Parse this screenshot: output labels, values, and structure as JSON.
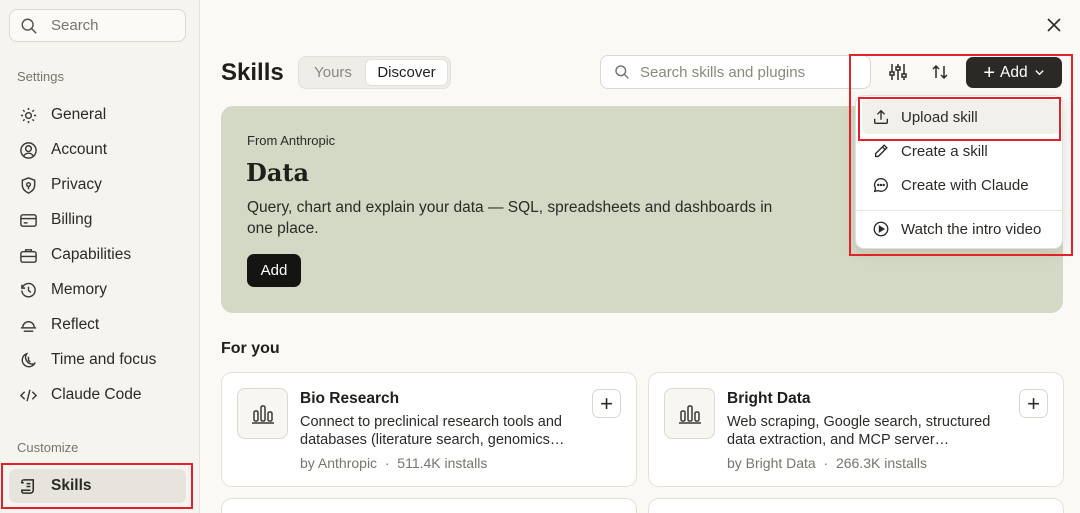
{
  "sidebar": {
    "search_placeholder": "Search",
    "settings_label": "Settings",
    "customize_label": "Customize",
    "items": [
      {
        "label": "General",
        "icon": "gear-icon"
      },
      {
        "label": "Account",
        "icon": "user-circle-icon"
      },
      {
        "label": "Privacy",
        "icon": "shield-icon"
      },
      {
        "label": "Billing",
        "icon": "credit-card-icon"
      },
      {
        "label": "Capabilities",
        "icon": "briefcase-icon"
      },
      {
        "label": "Memory",
        "icon": "history-icon"
      },
      {
        "label": "Reflect",
        "icon": "reflect-icon"
      },
      {
        "label": "Time and focus",
        "icon": "moon-icon"
      },
      {
        "label": "Claude Code",
        "icon": "code-icon"
      }
    ],
    "skills_label": "Skills"
  },
  "header": {
    "title": "Skills",
    "tabs": [
      "Yours",
      "Discover"
    ],
    "active_tab": "Discover",
    "search_placeholder": "Search skills and plugins",
    "add_label": "Add"
  },
  "add_menu": {
    "items": [
      {
        "label": "Upload skill",
        "icon": "upload-icon"
      },
      {
        "label": "Create a skill",
        "icon": "pencil-icon"
      },
      {
        "label": "Create with Claude",
        "icon": "chat-bubble-icon"
      },
      {
        "label": "Watch the intro video",
        "icon": "play-circle-icon"
      }
    ]
  },
  "banner": {
    "kicker": "From Anthropic",
    "title": "Data",
    "description": "Query, chart and explain your data — SQL, spreadsheets and dashboards in one place.",
    "button": "Add"
  },
  "for_you": {
    "heading": "For you",
    "cards": [
      {
        "title": "Bio Research",
        "description": "Connect to preclinical research tools and databases (literature search, genomics…",
        "author": "by Anthropic",
        "installs": "511.4K installs"
      },
      {
        "title": "Bright Data",
        "description": "Web scraping, Google search, structured data extraction, and MCP server…",
        "author": "by Bright Data",
        "installs": "266.3K installs"
      }
    ]
  },
  "colors": {
    "highlight": "#e4202a",
    "banner_bg": "#d3d9c4",
    "add_button": "#2a2926"
  }
}
